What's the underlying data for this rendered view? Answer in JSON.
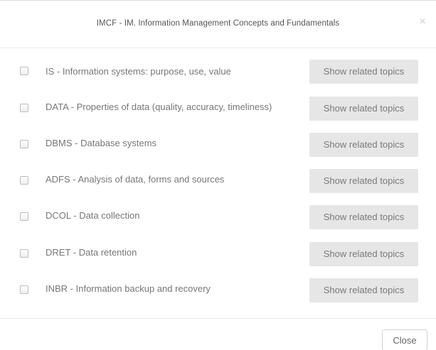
{
  "modal": {
    "title": "IMCF - IM. Information Management Concepts and Fundamentals",
    "close_glyph": "×",
    "close_label": "Close"
  },
  "topics": [
    {
      "label": "IS - Information systems: purpose, use, value",
      "button": "Show related topics"
    },
    {
      "label": "DATA - Properties of data (quality, accuracy, timeliness)",
      "button": "Show related topics"
    },
    {
      "label": "DBMS - Database systems",
      "button": "Show related topics"
    },
    {
      "label": "ADFS - Analysis of data, forms and sources",
      "button": "Show related topics"
    },
    {
      "label": "DCOL - Data collection",
      "button": "Show related topics"
    },
    {
      "label": "DRET - Data retention",
      "button": "Show related topics"
    },
    {
      "label": "INBR - Information backup and recovery",
      "button": "Show related topics"
    }
  ],
  "icons": {
    "close": "close-icon",
    "checkbox": "checkbox"
  }
}
